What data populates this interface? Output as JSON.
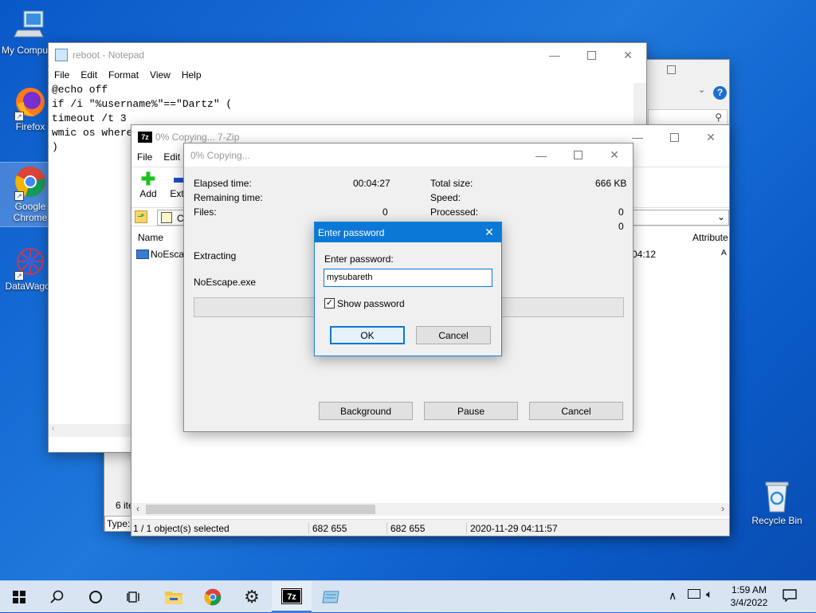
{
  "desktop": {
    "icons": [
      {
        "label": "My Computer",
        "icon": "computer-icon"
      },
      {
        "label": "Firefox",
        "icon": "firefox-icon"
      },
      {
        "label": "Google Chrome",
        "icon": "chrome-icon"
      },
      {
        "label": "DataWagon",
        "icon": "datawagon-icon"
      },
      {
        "label": "Recycle Bin",
        "icon": "recycle-bin-icon"
      }
    ]
  },
  "notepad": {
    "title": "reboot - Notepad",
    "menu": [
      "File",
      "Edit",
      "Format",
      "View",
      "Help"
    ],
    "lines": [
      "@echo off",
      "if /i \"%username%\"==\"Dartz\" (",
      "timeout /t 3",
      "wmic os where",
      ")"
    ]
  },
  "sevenzip": {
    "title": "0% Copying... 7-Zip",
    "menu": [
      "File",
      "Edit"
    ],
    "toolbar": {
      "add": "Add",
      "extract": "Extr"
    },
    "path_fragment": "C",
    "column_name": "Name",
    "column_attributes": "Attribute",
    "row_name": "NoEscap",
    "row_time": "04:12",
    "row_attr": "A",
    "back_count": "6 ite",
    "back_type": "Type:",
    "status": {
      "selected": "1 / 1 object(s) selected",
      "size": "682 655",
      "packed": "682 655",
      "modified": "2020-11-29 04:11:57"
    }
  },
  "copying": {
    "title": "0% Copying...",
    "elapsed_label": "Elapsed time:",
    "elapsed_value": "00:04:27",
    "remaining_label": "Remaining time:",
    "files_label": "Files:",
    "files_value": "0",
    "total_label": "Total size:",
    "total_value": "666 KB",
    "speed_label": "Speed:",
    "processed_label": "Processed:",
    "processed_value": "0",
    "extra_value": "0",
    "action": "Extracting",
    "filename": "NoEscape.exe",
    "progress": 0,
    "background": "Background",
    "pause": "Pause",
    "cancel": "Cancel"
  },
  "password_dialog": {
    "title": "Enter password",
    "prompt": "Enter password:",
    "value": "mysubareth",
    "show_password": "Show password",
    "show_checked": true,
    "ok": "OK",
    "cancel": "Cancel"
  },
  "taskbar": {
    "time": "1:59 AM",
    "date": "3/4/2022",
    "accent": "#3b7dd8"
  }
}
